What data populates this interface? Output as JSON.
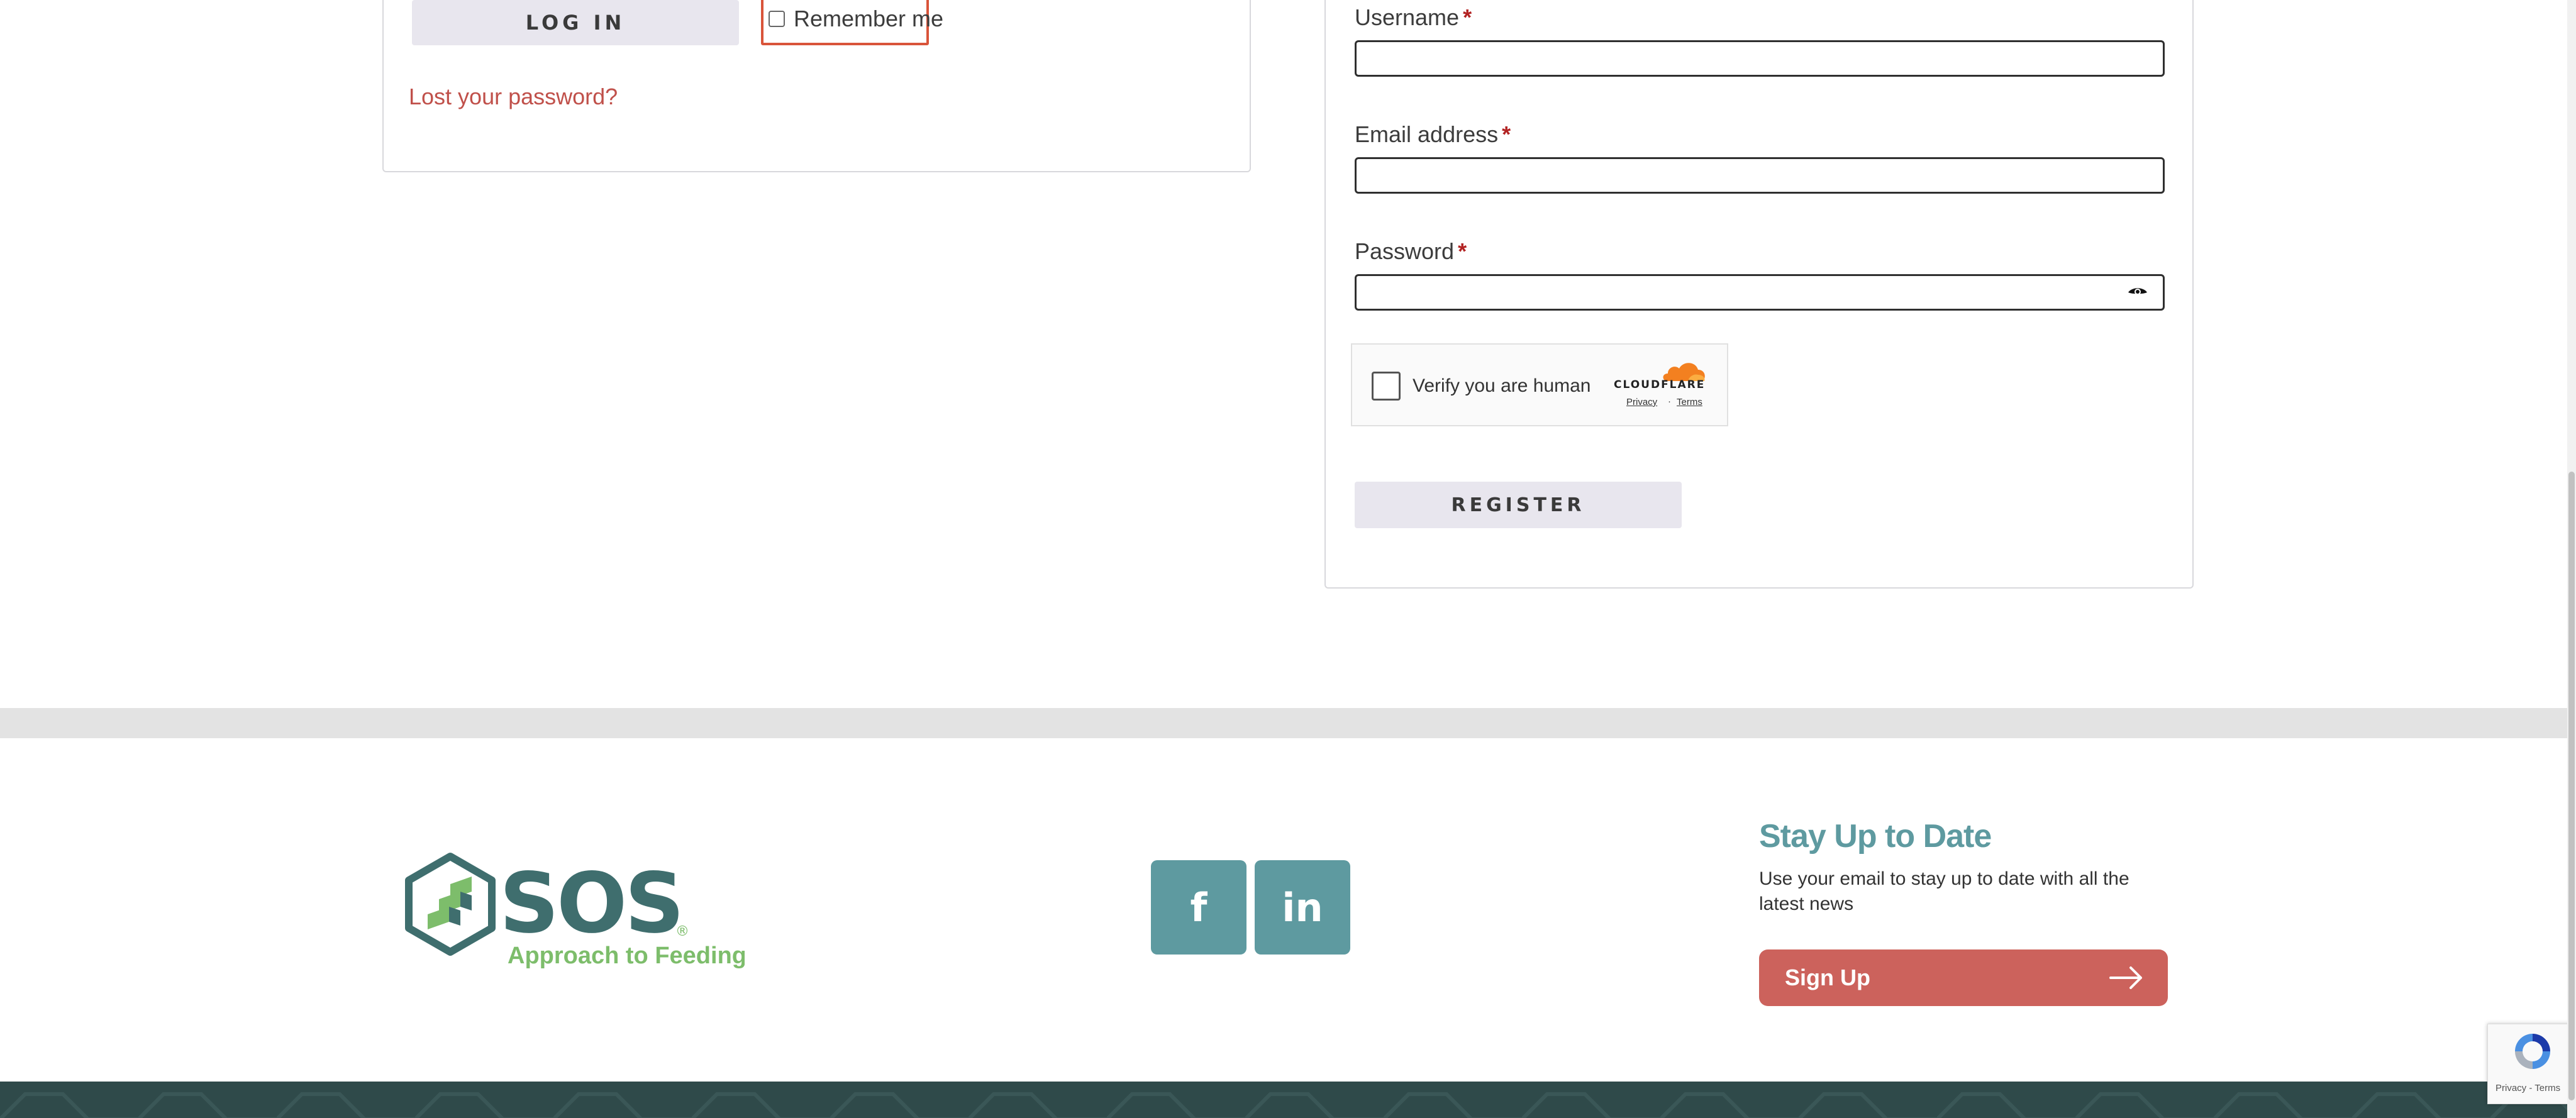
{
  "login": {
    "button_label": "LOG IN",
    "remember_label": "Remember me",
    "lost_password": "Lost your password?"
  },
  "register": {
    "username_label": "Username",
    "email_label": "Email address",
    "password_label": "Password",
    "required_marker": "*",
    "username_value": "",
    "email_value": "",
    "password_value": "",
    "button_label": "REGISTER"
  },
  "turnstile": {
    "label": "Verify you are human",
    "brand": "CLOUDFLARE",
    "privacy": "Privacy",
    "separator": "·",
    "terms": "Terms"
  },
  "footer": {
    "logo_text": "SOS",
    "logo_registered": "®",
    "logo_tagline": "Approach to Feeding",
    "facebook_glyph": "f",
    "linkedin_glyph": "in",
    "stay_title": "Stay Up to Date",
    "stay_text": "Use your email to stay up to date with all the latest news",
    "signup_label": "Sign Up"
  },
  "recaptcha": {
    "links": "Privacy - Terms"
  },
  "colors": {
    "accent_teal": "#5e9aa0",
    "logo_green": "#7dbd6b",
    "logo_dark": "#3f6e6e",
    "signup_red": "#cc625c",
    "link_red": "#c0504a",
    "highlight_orange": "#d9543a"
  },
  "icons": {
    "eye": "eye-icon",
    "facebook": "facebook-icon",
    "linkedin": "linkedin-icon",
    "arrow": "arrow-right-icon",
    "cloudflare": "cloudflare-cloud-icon",
    "recaptcha": "recaptcha-icon"
  }
}
